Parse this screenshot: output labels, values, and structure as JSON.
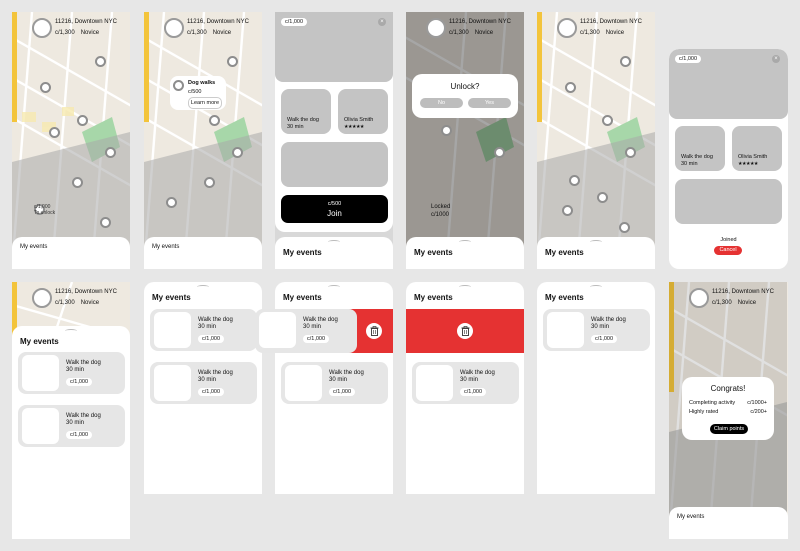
{
  "header": {
    "location": "11216, Downtown NYC",
    "coins": "c/1,300",
    "rank": "Novice"
  },
  "bottom_sheet": {
    "title": "My events"
  },
  "map_labels": {
    "unlock_price": "c/1,000",
    "to_unlock": "To unlock",
    "locked": "Locked",
    "locked_price": "c/1000"
  },
  "popup": {
    "title": "Dog walks",
    "price": "c/500",
    "action": "Learn more"
  },
  "detail": {
    "cost_chip": "c/1,000",
    "event_name": "Walk the dog",
    "event_duration": "30 min",
    "host_name": "Olivia Smith",
    "host_rating": "★★★★★",
    "join_price": "c/500",
    "join_label": "Join",
    "joined_label": "Joined",
    "cancel_label": "Cancel",
    "close_glyph": "×"
  },
  "unlock_dialog": {
    "title": "Unlock?",
    "no": "No",
    "yes": "Yes"
  },
  "events": [
    {
      "name": "Walk the dog",
      "duration": "30 min",
      "price": "c/1,000"
    },
    {
      "name": "Walk the dog",
      "duration": "30 min",
      "price": "c/1,000"
    }
  ],
  "congrats": {
    "title": "Congrats!",
    "rows": [
      {
        "label": "Completing activity",
        "value": "c/1000+"
      },
      {
        "label": "Highly rated",
        "value": "c/200+"
      }
    ],
    "claim": "Claim points"
  },
  "colors": {
    "accent_red": "#e53232",
    "join_black": "#000000",
    "card_gray": "#c4c4c4"
  },
  "icons": {
    "close": "close-icon",
    "trash": "trash-icon",
    "pin": "map-pin-icon",
    "avatar": "avatar-icon"
  }
}
